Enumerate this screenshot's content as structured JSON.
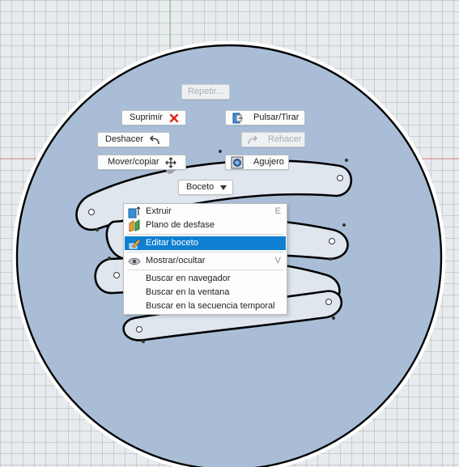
{
  "marking_menu": {
    "repeat": "Repetir...",
    "delete": "Suprimir",
    "press_pull": "Pulsar/Tirar",
    "undo": "Deshacer",
    "redo": "Rehacer",
    "move_copy": "Mover/copiar",
    "hole": "Agujero",
    "sketch": "Boceto"
  },
  "context_menu": {
    "items": [
      {
        "label": "Extruir",
        "shortcut": "E",
        "icon": "extrude-icon"
      },
      {
        "label": "Plano de desfase",
        "shortcut": "",
        "icon": "offset-plane-icon"
      },
      {
        "label": "Editar boceto",
        "shortcut": "",
        "icon": "edit-sketch-icon"
      },
      {
        "label": "Mostrar/ocultar",
        "shortcut": "V",
        "icon": "eye-icon"
      },
      {
        "label": "Buscar en navegador",
        "shortcut": ""
      },
      {
        "label": "Buscar en la ventana",
        "shortcut": ""
      },
      {
        "label": "Buscar en la secuencia temporal",
        "shortcut": ""
      }
    ],
    "highlighted_index": 2
  },
  "colors": {
    "disk_fill": "#a9bed6",
    "selection_blue": "#0e7fd1",
    "delete_red": "#e0231b"
  }
}
